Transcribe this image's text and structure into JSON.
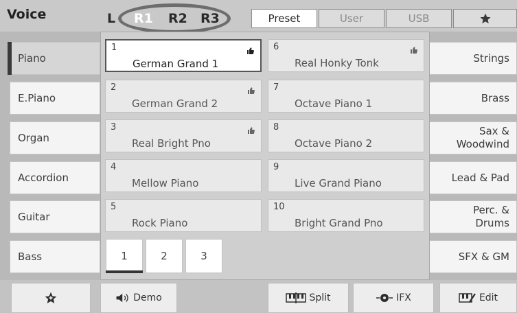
{
  "header": {
    "title": "Voice",
    "parts": [
      "L",
      "R1",
      "R2",
      "R3"
    ],
    "active_part": "R1",
    "tabs": [
      {
        "label": "Preset"
      },
      {
        "label": "User"
      },
      {
        "label": "USB"
      },
      {
        "label": "",
        "icon": "star-icon"
      }
    ],
    "selected_tab": "Preset"
  },
  "left_categories": [
    {
      "label": "Piano"
    },
    {
      "label": "E.Piano"
    },
    {
      "label": "Organ"
    },
    {
      "label": "Accordion"
    },
    {
      "label": "Guitar"
    },
    {
      "label": "Bass"
    }
  ],
  "selected_category": "Piano",
  "right_categories": [
    {
      "label": "Strings"
    },
    {
      "label": "Brass"
    },
    {
      "label": "Sax &\nWoodwind"
    },
    {
      "label": "Lead & Pad"
    },
    {
      "label": "Perc. &\nDrums"
    },
    {
      "label": "SFX & GM"
    }
  ],
  "voices": [
    {
      "num": "1",
      "name": "German Grand 1",
      "favorite": true
    },
    {
      "num": "2",
      "name": "German Grand 2",
      "favorite": true
    },
    {
      "num": "3",
      "name": "Real Bright Pno",
      "favorite": true
    },
    {
      "num": "4",
      "name": "Mellow Piano",
      "favorite": false
    },
    {
      "num": "5",
      "name": "Rock Piano",
      "favorite": false
    },
    {
      "num": "6",
      "name": "Real Honky Tonk",
      "favorite": true
    },
    {
      "num": "7",
      "name": "Octave Piano 1",
      "favorite": false
    },
    {
      "num": "8",
      "name": "Octave Piano 2",
      "favorite": false
    },
    {
      "num": "9",
      "name": "Live Grand Piano",
      "favorite": false
    },
    {
      "num": "10",
      "name": "Bright Grand Pno",
      "favorite": false
    }
  ],
  "selected_voice": "1",
  "pages": [
    "1",
    "2",
    "3"
  ],
  "current_page": "1",
  "bottom_bar": {
    "favorite_icon": "star-add-icon",
    "demo_label": "Demo",
    "split_label": "Split",
    "ifx_label": "IFX",
    "edit_label": "Edit"
  }
}
